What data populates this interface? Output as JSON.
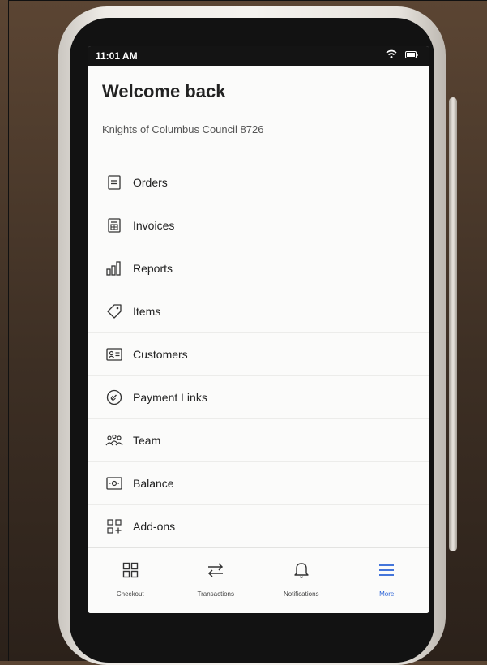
{
  "status_bar": {
    "time": "11:01 AM"
  },
  "header": {
    "title": "Welcome back",
    "organization": "Knights of Columbus Council 8726"
  },
  "menu": {
    "items": [
      {
        "label": "Orders",
        "icon": "orders-icon"
      },
      {
        "label": "Invoices",
        "icon": "invoices-icon"
      },
      {
        "label": "Reports",
        "icon": "reports-icon"
      },
      {
        "label": "Items",
        "icon": "items-tag-icon"
      },
      {
        "label": "Customers",
        "icon": "customers-card-icon"
      },
      {
        "label": "Payment Links",
        "icon": "payment-links-icon"
      },
      {
        "label": "Team",
        "icon": "team-icon"
      },
      {
        "label": "Balance",
        "icon": "balance-icon"
      },
      {
        "label": "Add-ons",
        "icon": "add-ons-icon"
      }
    ]
  },
  "tab_bar": {
    "tabs": [
      {
        "label": "Checkout",
        "icon": "grid-icon",
        "active": false
      },
      {
        "label": "Transactions",
        "icon": "swap-arrows-icon",
        "active": false
      },
      {
        "label": "Notifications",
        "icon": "bell-icon",
        "active": false
      },
      {
        "label": "More",
        "icon": "hamburger-menu-icon",
        "active": true
      }
    ]
  },
  "colors": {
    "accent": "#2a62d6",
    "text": "#222222",
    "muted": "#555555",
    "background": "#fbfbfa"
  }
}
